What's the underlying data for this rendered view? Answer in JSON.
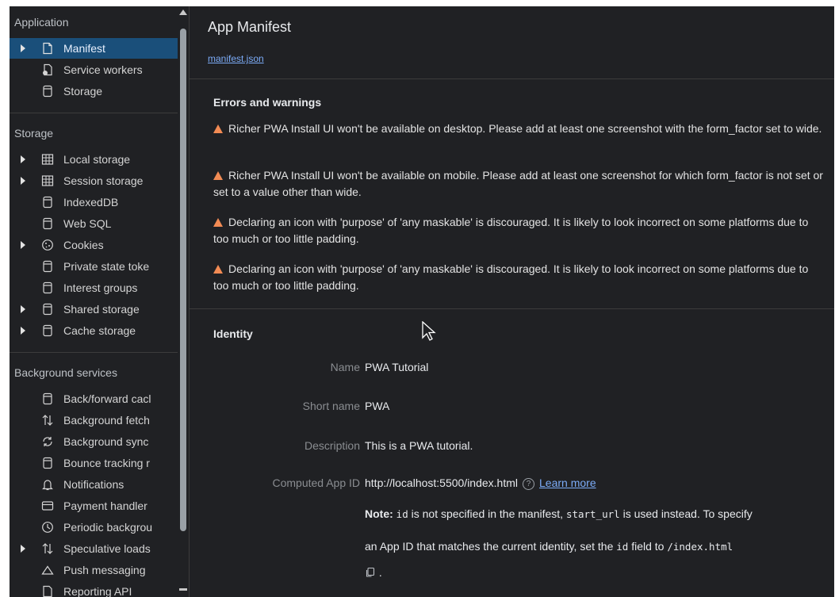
{
  "sidebar": {
    "application": {
      "title": "Application",
      "items": [
        {
          "label": "Manifest",
          "icon": "document-icon",
          "expandable": true,
          "selected": true
        },
        {
          "label": "Service workers",
          "icon": "service-worker-icon"
        },
        {
          "label": "Storage",
          "icon": "database-icon"
        }
      ]
    },
    "storage": {
      "title": "Storage",
      "items": [
        {
          "label": "Local storage",
          "icon": "table-icon",
          "expandable": true
        },
        {
          "label": "Session storage",
          "icon": "table-icon",
          "expandable": true
        },
        {
          "label": "IndexedDB",
          "icon": "database-icon"
        },
        {
          "label": "Web SQL",
          "icon": "database-icon"
        },
        {
          "label": "Cookies",
          "icon": "cookie-icon",
          "expandable": true
        },
        {
          "label": "Private state toke",
          "icon": "database-icon"
        },
        {
          "label": "Interest groups",
          "icon": "database-icon"
        },
        {
          "label": "Shared storage",
          "icon": "database-icon",
          "expandable": true
        },
        {
          "label": "Cache storage",
          "icon": "database-icon",
          "expandable": true
        }
      ]
    },
    "background": {
      "title": "Background services",
      "items": [
        {
          "label": "Back/forward cacl",
          "icon": "database-icon"
        },
        {
          "label": "Background fetch",
          "icon": "up-down-arrows-icon"
        },
        {
          "label": "Background sync",
          "icon": "sync-icon"
        },
        {
          "label": "Bounce tracking r",
          "icon": "database-icon"
        },
        {
          "label": "Notifications",
          "icon": "bell-icon"
        },
        {
          "label": "Payment handler",
          "icon": "card-icon"
        },
        {
          "label": "Periodic backgrou",
          "icon": "clock-icon"
        },
        {
          "label": "Speculative loads",
          "icon": "up-down-arrows-icon",
          "expandable": true
        },
        {
          "label": "Push messaging",
          "icon": "cloud-icon"
        },
        {
          "label": "Reporting API",
          "icon": "document-icon"
        }
      ]
    }
  },
  "main": {
    "title": "App Manifest",
    "manifest_link": "manifest.json",
    "errors": {
      "heading": "Errors and warnings",
      "items": [
        "Richer PWA Install UI won't be available on desktop. Please add at least one screenshot with the form_factor set to wide.",
        "Richer PWA Install UI won't be available on mobile. Please add at least one screenshot for which form_factor is not set or set to a value other than wide.",
        "Declaring an icon with 'purpose' of 'any maskable' is discouraged. It is likely to look incorrect on some platforms due to too much or too little padding.",
        "Declaring an icon with 'purpose' of 'any maskable' is discouraged. It is likely to look incorrect on some platforms due to too much or too little padding."
      ]
    },
    "identity": {
      "heading": "Identity",
      "name_label": "Name",
      "name_value": "PWA Tutorial",
      "short_label": "Short name",
      "short_value": "PWA",
      "desc_label": "Description",
      "desc_value": "This is a PWA tutorial.",
      "appid_label": "Computed App ID",
      "appid_value": "http://localhost:5500/index.html",
      "help_glyph": "?",
      "learn_more": "Learn more",
      "note_bold": "Note:",
      "note_id": "id",
      "note_mid": " is not specified in the manifest, ",
      "note_start": "start_url",
      "note_end": " is used instead. To specify",
      "note2_pre": "an App ID that matches the current identity, set the ",
      "note2_id": "id",
      "note2_mid": " field to ",
      "note2_path": "/index.html",
      "note3_end": "."
    }
  },
  "colors": {
    "background": "#202124",
    "selected": "#1a4f7a",
    "link": "#7cacf8",
    "warning": "#f28b54"
  }
}
